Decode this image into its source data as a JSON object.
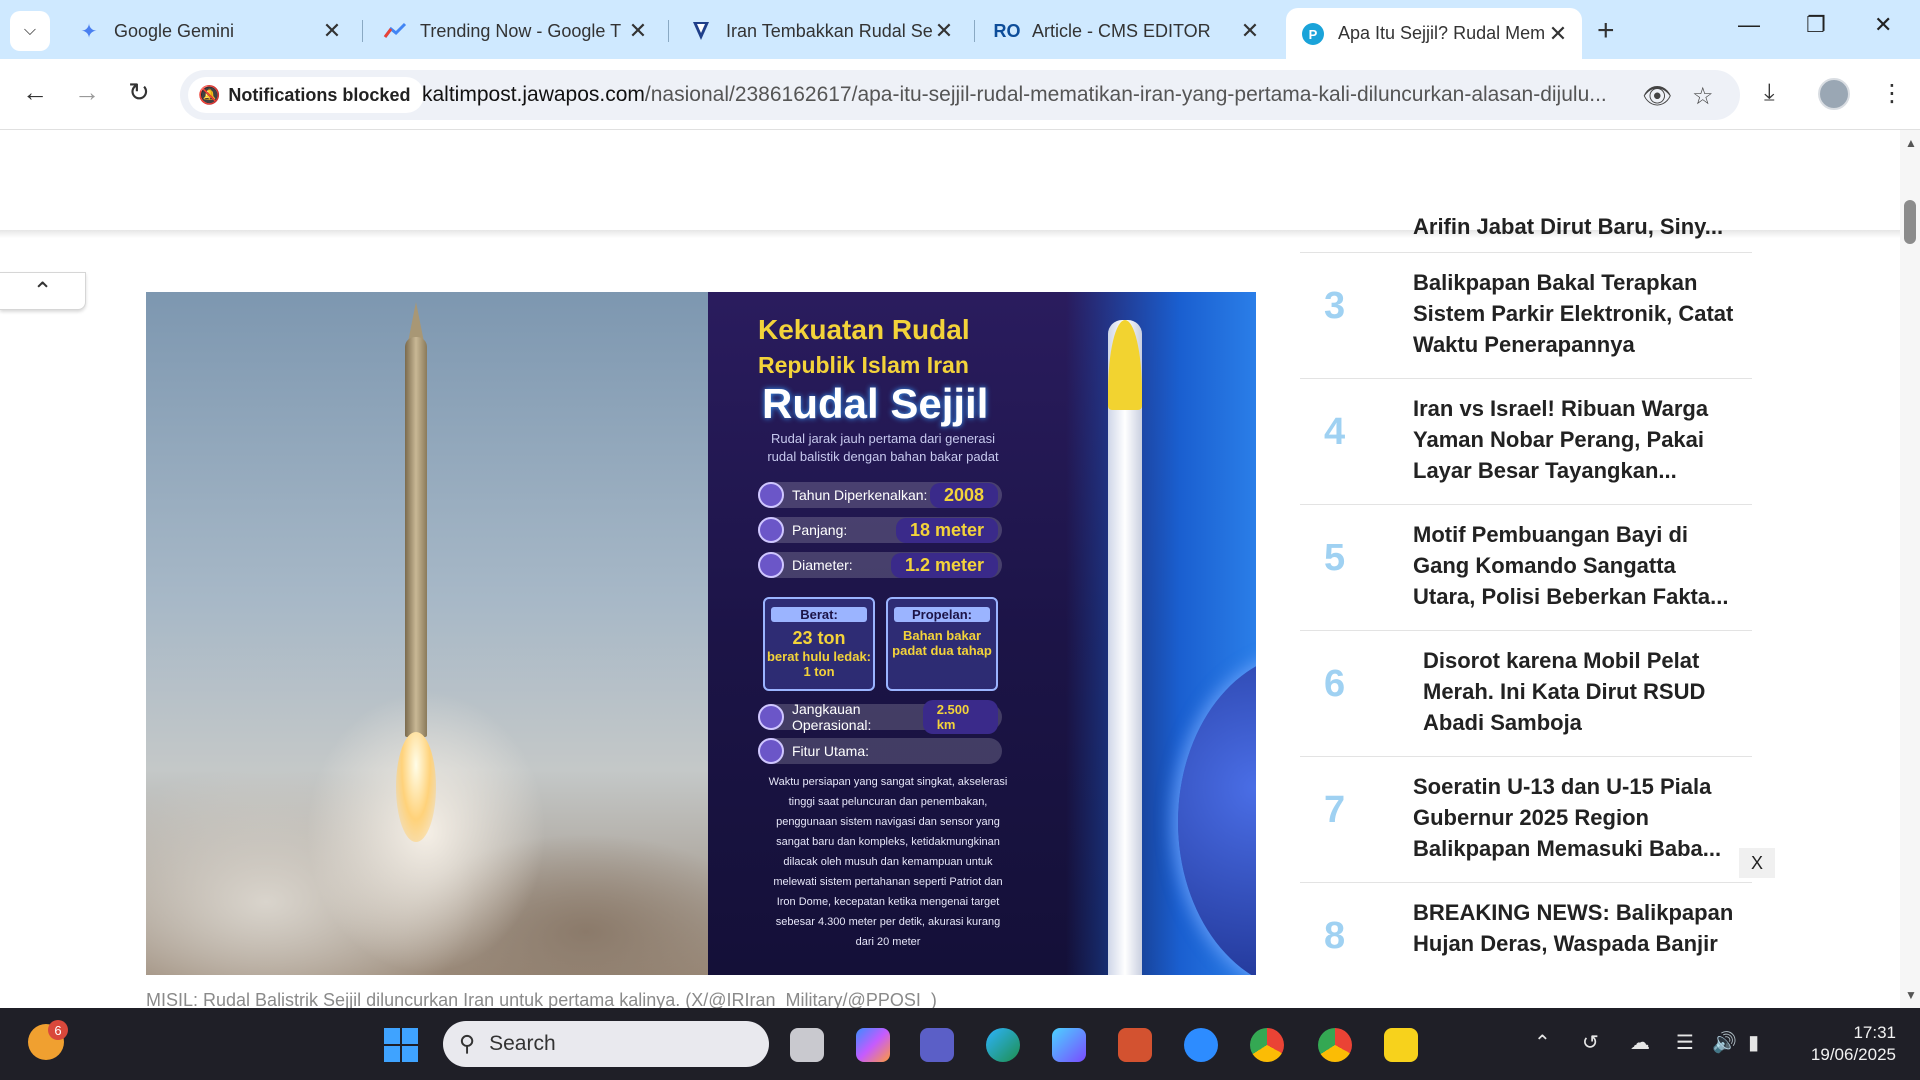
{
  "tabs": [
    {
      "title": "Google Gemini",
      "icon": "gemini-sparkle-icon"
    },
    {
      "title": "Trending Now - Google T",
      "icon": "trends-icon"
    },
    {
      "title": "Iran Tembakkan Rudal Se",
      "icon": "site-icon"
    },
    {
      "title": "Article - CMS EDITOR",
      "icon": "cms-icon"
    },
    {
      "title": "Apa Itu Sejjil? Rudal Mem",
      "icon": "jawapos-icon",
      "active": true
    }
  ],
  "toolbar": {
    "notifications_chip": "Notifications blocked",
    "url_host": "kaltimpost.jawapos.com",
    "url_path": "/nasional/2386162617/apa-itu-sejjil-rudal-mematikan-iran-yang-pertama-kali-diluncurkan-alasan-dijulu..."
  },
  "infographic": {
    "title_line1": "Kekuatan Rudal",
    "title_line2": "Republik Islam Iran",
    "title_line3": "Rudal Sejjil",
    "subtitle": "Rudal jarak jauh pertama dari generasi rudal balistik dengan bahan bakar padat",
    "specs": [
      {
        "label": "Tahun Diperkenalkan:",
        "value": "2008"
      },
      {
        "label": "Panjang:",
        "value": "18 meter"
      },
      {
        "label": "Diameter:",
        "value": "1.2 meter"
      }
    ],
    "weight": {
      "label": "Berat:",
      "value": "23 ton",
      "note": "berat hulu ledak: 1 ton"
    },
    "propellant": {
      "label": "Propelan:",
      "value": "Bahan bakar padat dua tahap"
    },
    "range": {
      "label": "Jangkauan Operasional:",
      "value": "2.500 km"
    },
    "features_label": "Fitur Utama:",
    "features_text": "Waktu persiapan yang sangat singkat, akselerasi tinggi saat peluncuran dan penembakan, penggunaan sistem navigasi dan sensor yang sangat baru dan kompleks, ketidakmungkinan dilacak oleh musuh dan kemampuan untuk melewati sistem pertahanan seperti Patriot dan Iron Dome, kecepatan ketika mengenai target sebesar 4.300 meter per detik, akurasi kurang dari 20 meter"
  },
  "caption": "MISIL: Rudal Balistrik Sejjil diluncurkan Iran untuk pertama kalinya. (X/@IRIran_Military/@PPOSI_)",
  "sidebar": {
    "partial_top": "Arifin Jabat Dirut Baru, Siny...",
    "items": [
      {
        "num": "3",
        "title": "Balikpapan Bakal Terapkan Sistem Parkir Elektronik, Catat Waktu Penerapannya"
      },
      {
        "num": "4",
        "title": "Iran vs Israel! Ribuan Warga Yaman Nobar Perang, Pakai Layar Besar Tayangkan..."
      },
      {
        "num": "5",
        "title": "Motif Pembuangan Bayi di Gang Komando Sangatta Utara, Polisi Beberkan Fakta..."
      },
      {
        "num": "6",
        "title": "Disorot karena Mobil Pelat Merah. Ini Kata Dirut RSUD Abadi Samboja"
      },
      {
        "num": "7",
        "title": "Soeratin U-13 dan U-15 Piala Gubernur 2025 Region Balikpapan Memasuki Baba..."
      },
      {
        "num": "8",
        "title": "BREAKING NEWS: Balikpapan Hujan Deras, Waspada Banjir"
      }
    ],
    "close_label": "X"
  },
  "taskbar": {
    "weather_badge": "6",
    "search_placeholder": "Search",
    "time": "17:31",
    "date": "19/06/2025"
  },
  "colors": {
    "tabstrip": "#cfe9ff",
    "rank_number": "#9fd1f2",
    "infographic_yellow": "#f3d33a",
    "taskbar": "#1f1f27"
  }
}
